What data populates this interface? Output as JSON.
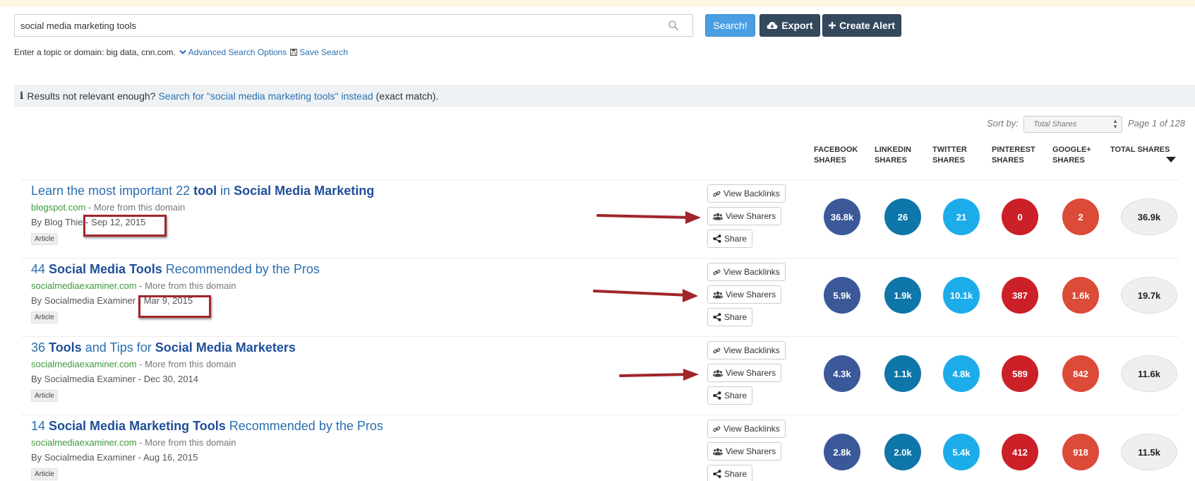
{
  "search": {
    "value": "social media marketing tools",
    "search_label": "Search!",
    "export_label": "Export",
    "alert_label": "Create Alert"
  },
  "hint": {
    "text": "Enter a topic or domain: big data, cnn.com.",
    "advanced_label": "Advanced Search Options",
    "save_label": "Save Search"
  },
  "notice": {
    "prefix": "Results not relevant enough?",
    "link_text": "Search for \"social media marketing tools\" instead",
    "suffix": "(exact match)."
  },
  "sort": {
    "label": "Sort by:",
    "selected": "Total Shares",
    "page_label": "Page 1 of 128"
  },
  "columns": [
    {
      "line1": "FACEBOOK",
      "line2": "SHARES"
    },
    {
      "line1": "LINKEDIN",
      "line2": "SHARES"
    },
    {
      "line1": "TWITTER",
      "line2": "SHARES"
    },
    {
      "line1": "PINTEREST",
      "line2": "SHARES"
    },
    {
      "line1": "GOOGLE+",
      "line2": "SHARES"
    },
    {
      "line1": "TOTAL SHARES",
      "line2": ""
    }
  ],
  "colors": {
    "facebook": "#3b5998",
    "linkedin": "#0e76a8",
    "twitter": "#1dacea",
    "pinterest": "#cb2027",
    "googleplus": "#dc4a38",
    "annotation_red": "#a1262b"
  },
  "actions": {
    "backlinks": "View Backlinks",
    "sharers": "View Sharers",
    "share": "Share"
  },
  "results": [
    {
      "title_parts": [
        {
          "text": "Learn the most important 22 ",
          "bold": false
        },
        {
          "text": "tool",
          "bold": true
        },
        {
          "text": " in ",
          "bold": false
        },
        {
          "text": "Social Media Marketing",
          "bold": true
        }
      ],
      "domain": "blogspot.com",
      "more": " - More from this domain",
      "author": "By Blog Thie",
      "date": "Sep 12, 2015",
      "tag": "Article",
      "facebook": "36.8k",
      "linkedin": "26",
      "twitter": "21",
      "pinterest": "0",
      "googleplus": "2",
      "total": "36.9k"
    },
    {
      "title_parts": [
        {
          "text": "44 ",
          "bold": false
        },
        {
          "text": "Social Media Tools",
          "bold": true
        },
        {
          "text": " Recommended by the Pros",
          "bold": false
        }
      ],
      "domain": "socialmediaexaminer.com",
      "more": " - More from this domain",
      "author": "By Socialmedia Examiner",
      "date": "Mar 9, 2015",
      "tag": "Article",
      "facebook": "5.9k",
      "linkedin": "1.9k",
      "twitter": "10.1k",
      "pinterest": "387",
      "googleplus": "1.6k",
      "total": "19.7k"
    },
    {
      "title_parts": [
        {
          "text": "36 ",
          "bold": false
        },
        {
          "text": "Tools",
          "bold": true
        },
        {
          "text": " and Tips for ",
          "bold": false
        },
        {
          "text": "Social Media Marketers",
          "bold": true
        }
      ],
      "domain": "socialmediaexaminer.com",
      "more": " - More from this domain",
      "author": "By Socialmedia Examiner",
      "date": "Dec 30, 2014",
      "tag": "Article",
      "facebook": "4.3k",
      "linkedin": "1.1k",
      "twitter": "4.8k",
      "pinterest": "589",
      "googleplus": "842",
      "total": "11.6k"
    },
    {
      "title_parts": [
        {
          "text": "14 ",
          "bold": false
        },
        {
          "text": "Social Media Marketing Tools",
          "bold": true
        },
        {
          "text": " Recommended by the Pros",
          "bold": false
        }
      ],
      "domain": "socialmediaexaminer.com",
      "more": " - More from this domain",
      "author": "By Socialmedia Examiner",
      "date": "Aug 16, 2015",
      "tag": "Article",
      "facebook": "2.8k",
      "linkedin": "2.0k",
      "twitter": "5.4k",
      "pinterest": "412",
      "googleplus": "918",
      "total": "11.5k"
    }
  ]
}
